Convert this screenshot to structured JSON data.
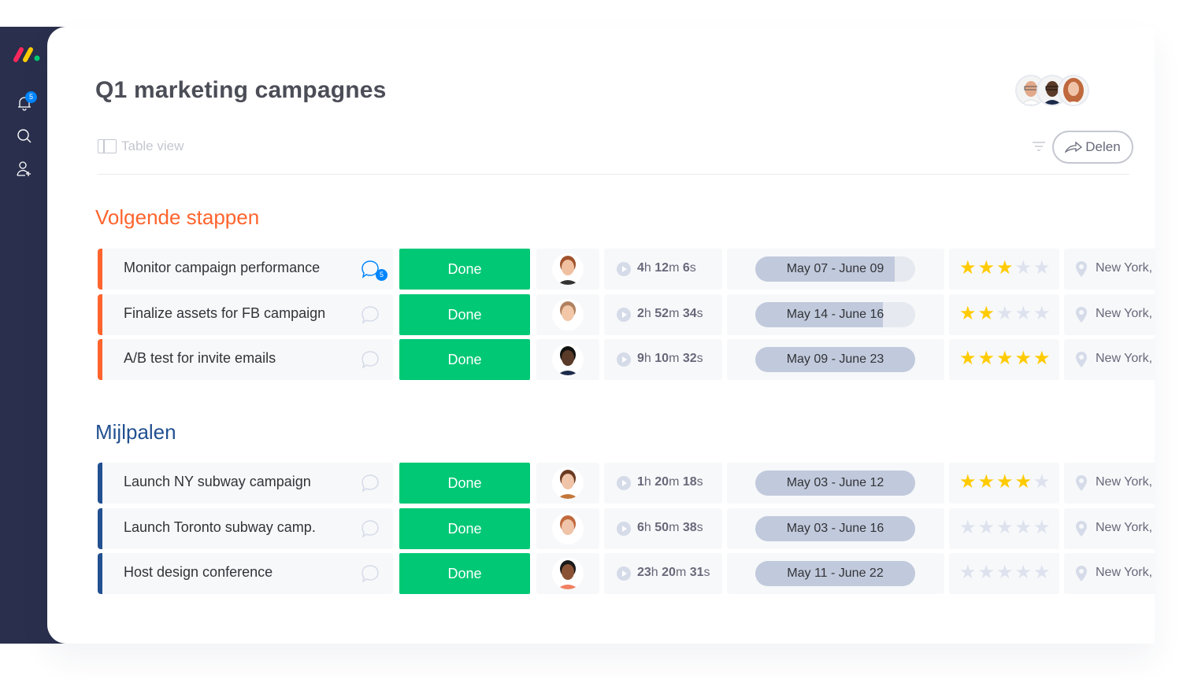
{
  "app": {
    "notification_count": "5"
  },
  "board": {
    "title": "Q1 marketing campagnes",
    "view_label": "Table view",
    "share_label": "Delen",
    "members": [
      "member-1",
      "member-2",
      "member-3"
    ]
  },
  "colors": {
    "sidebar": "#292f4c",
    "status_done": "#00c875",
    "group_1": "#ff642e",
    "group_2": "#225091",
    "star_filled": "#ffcb00",
    "star_empty": "#dde2ee",
    "timeline_fill": "#c1cadc"
  },
  "groups": [
    {
      "title": "Volgende stappen",
      "rows": [
        {
          "task": "Monitor campaign performance",
          "comments": "5",
          "status": "Done",
          "time_h": "4",
          "time_m": "12",
          "time_s": "6",
          "timeline": "May 07 - June 09",
          "timeline_progress": 0.87,
          "rating": 3,
          "location": "New York,"
        },
        {
          "task": "Finalize assets for FB campaign",
          "comments": "",
          "status": "Done",
          "time_h": "2",
          "time_m": "52",
          "time_s": "34",
          "timeline": "May 14 - June 16",
          "timeline_progress": 0.8,
          "rating": 2,
          "location": "New York,"
        },
        {
          "task": "A/B test for invite emails",
          "comments": "",
          "status": "Done",
          "time_h": "9",
          "time_m": "10",
          "time_s": "32",
          "timeline": "May 09 - June 23",
          "timeline_progress": 1.0,
          "rating": 5,
          "location": "New York,"
        }
      ]
    },
    {
      "title": "Mijlpalen",
      "rows": [
        {
          "task": "Launch NY subway campaign",
          "comments": "",
          "status": "Done",
          "time_h": "1",
          "time_m": "20",
          "time_s": "18",
          "timeline": "May 03 - June 12",
          "timeline_progress": 1.0,
          "rating": 4,
          "location": "New York,"
        },
        {
          "task": "Launch Toronto subway camp.",
          "comments": "",
          "status": "Done",
          "time_h": "6",
          "time_m": "50",
          "time_s": "38",
          "timeline": "May 03 - June 16",
          "timeline_progress": 1.0,
          "rating": 0,
          "location": "New York,"
        },
        {
          "task": "Host design conference",
          "comments": "",
          "status": "Done",
          "time_h": "23",
          "time_m": "20",
          "time_s": "31",
          "timeline": "May 11 - June 22",
          "timeline_progress": 1.0,
          "rating": 0,
          "location": "New York,"
        }
      ]
    }
  ],
  "units": {
    "h": "h",
    "m": "m",
    "s": "s"
  },
  "icons": {
    "logo": "monday-logo",
    "bell": "bell-icon",
    "search": "search-icon",
    "invite": "add-user-icon",
    "filter": "filter-icon",
    "share": "share-arrow-icon",
    "chat": "chat-bubble-icon",
    "play": "play-icon",
    "star": "star-icon",
    "pin": "location-pin-icon"
  }
}
